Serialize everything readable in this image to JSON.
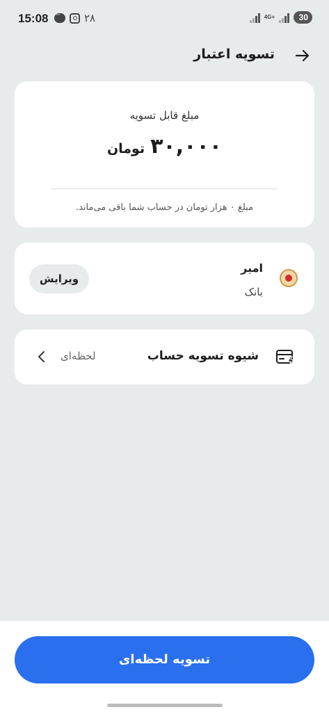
{
  "status_bar": {
    "time": "15:08",
    "notification_count": "۲۸",
    "network_label": "4G+",
    "battery": "30"
  },
  "header": {
    "title": "تسویه اعتبار",
    "back_icon": "arrow-right-icon"
  },
  "amount_card": {
    "label": "مبلغ قابل تسویه",
    "value": "۳۰,۰۰۰",
    "unit": "تومان",
    "note": "مبلغ ۰ هزار تومان در حساب شما باقی می‌ماند."
  },
  "account_card": {
    "name": "امیر",
    "bank": "بانک",
    "edit_label": "ویرایش",
    "bank_logo_icon": "bank-logo-icon"
  },
  "method_card": {
    "label": "شیوه تسویه حساب",
    "value": "لحظه‌ای",
    "icon": "instant-payment-icon",
    "chevron_icon": "chevron-left-icon"
  },
  "footer": {
    "primary_label": "تسویه لحظه‌ای"
  },
  "colors": {
    "background": "#e8ebec",
    "card": "#ffffff",
    "accent": "#2a6fee"
  }
}
